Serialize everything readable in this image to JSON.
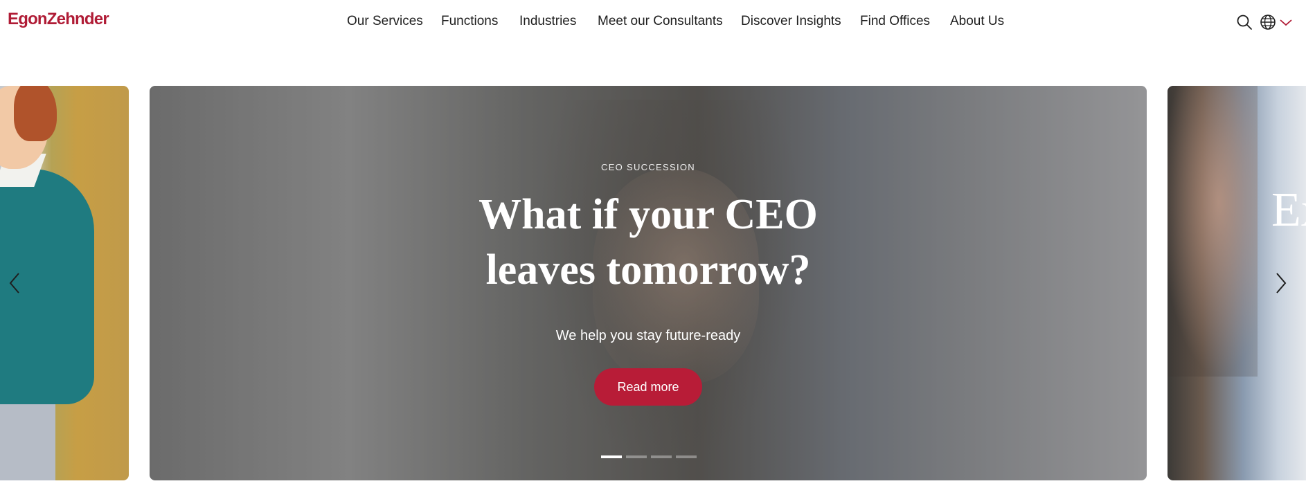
{
  "header": {
    "logo": "EgonZehnder",
    "nav": [
      {
        "label": "Our Services"
      },
      {
        "label": "Functions"
      },
      {
        "label": "Industries"
      },
      {
        "label": "Meet our Consultants"
      },
      {
        "label": "Discover Insights"
      },
      {
        "label": "Find Offices"
      },
      {
        "label": "About Us"
      }
    ],
    "icons": [
      "search-icon",
      "globe-icon",
      "chevron-down-icon"
    ]
  },
  "carousel": {
    "current_slide": {
      "kicker": "CEO SUCCESSION",
      "headline_line1": "What if your CEO",
      "headline_line2": "leaves tomorrow?",
      "subline": "We help you stay future-ready",
      "cta_label": "Read more"
    },
    "next_slide_peek_text": "Ex",
    "dot_count": 4,
    "active_dot": 1,
    "controls": [
      "chevron-left-icon",
      "chevron-right-icon"
    ]
  },
  "colors": {
    "brand": "#b01c36",
    "cta": "#b81c37",
    "nav_text": "#1e1e1e",
    "white": "#ffffff"
  }
}
